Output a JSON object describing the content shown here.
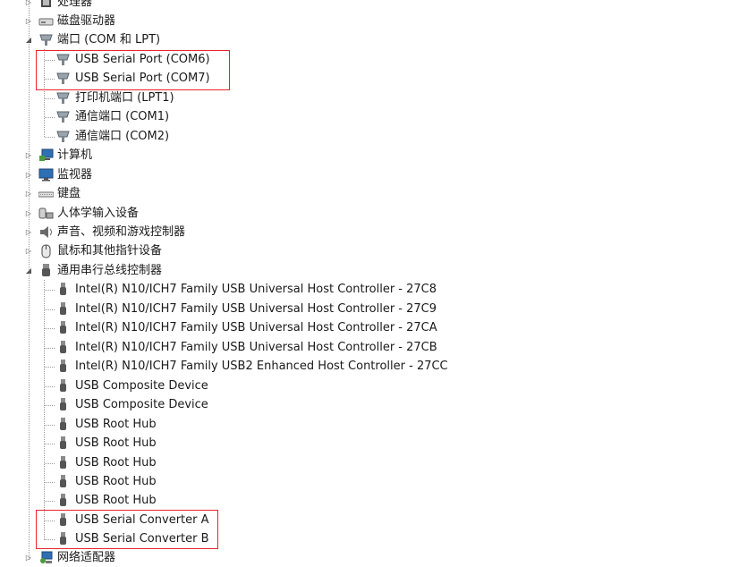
{
  "tree": {
    "top_partial": {
      "label": "处理器",
      "icon": "processor-icon"
    },
    "disk": {
      "label": "磁盘驱动器",
      "icon": "disk-drive-icon"
    },
    "ports": {
      "label": "端口 (COM 和 LPT)",
      "icon": "port-icon",
      "children": [
        {
          "label": "USB Serial Port (COM6)",
          "icon": "port-icon"
        },
        {
          "label": "USB Serial Port (COM7)",
          "icon": "port-icon"
        },
        {
          "label": "打印机端口 (LPT1)",
          "icon": "port-icon"
        },
        {
          "label": "通信端口 (COM1)",
          "icon": "port-icon"
        },
        {
          "label": "通信端口 (COM2)",
          "icon": "port-icon"
        }
      ]
    },
    "computer": {
      "label": "计算机",
      "icon": "computer-icon"
    },
    "monitor": {
      "label": "监视器",
      "icon": "monitor-icon"
    },
    "keyboard": {
      "label": "键盘",
      "icon": "keyboard-icon"
    },
    "hid": {
      "label": "人体学输入设备",
      "icon": "hid-icon"
    },
    "sound": {
      "label": "声音、视频和游戏控制器",
      "icon": "speaker-icon"
    },
    "mouse": {
      "label": "鼠标和其他指针设备",
      "icon": "mouse-icon"
    },
    "usb": {
      "label": "通用串行总线控制器",
      "icon": "usb-icon",
      "children": [
        {
          "label": "Intel(R) N10/ICH7 Family USB Universal Host Controller - 27C8",
          "icon": "usb-icon"
        },
        {
          "label": "Intel(R) N10/ICH7 Family USB Universal Host Controller - 27C9",
          "icon": "usb-icon"
        },
        {
          "label": "Intel(R) N10/ICH7 Family USB Universal Host Controller - 27CA",
          "icon": "usb-icon"
        },
        {
          "label": "Intel(R) N10/ICH7 Family USB Universal Host Controller - 27CB",
          "icon": "usb-icon"
        },
        {
          "label": "Intel(R) N10/ICH7 Family USB2 Enhanced Host Controller - 27CC",
          "icon": "usb-icon"
        },
        {
          "label": "USB Composite Device",
          "icon": "usb-icon"
        },
        {
          "label": "USB Composite Device",
          "icon": "usb-icon"
        },
        {
          "label": "USB Root Hub",
          "icon": "usb-icon"
        },
        {
          "label": "USB Root Hub",
          "icon": "usb-icon"
        },
        {
          "label": "USB Root Hub",
          "icon": "usb-icon"
        },
        {
          "label": "USB Root Hub",
          "icon": "usb-icon"
        },
        {
          "label": "USB Root Hub",
          "icon": "usb-icon"
        },
        {
          "label": "USB Serial Converter A",
          "icon": "usb-icon"
        },
        {
          "label": "USB Serial Converter B",
          "icon": "usb-icon"
        }
      ]
    },
    "network": {
      "label": "网络适配器",
      "icon": "network-adapter-icon"
    }
  },
  "colors": {
    "highlight": "#e8252b",
    "tree_lines": "#9a9a9a",
    "text": "#1a1a1a"
  }
}
